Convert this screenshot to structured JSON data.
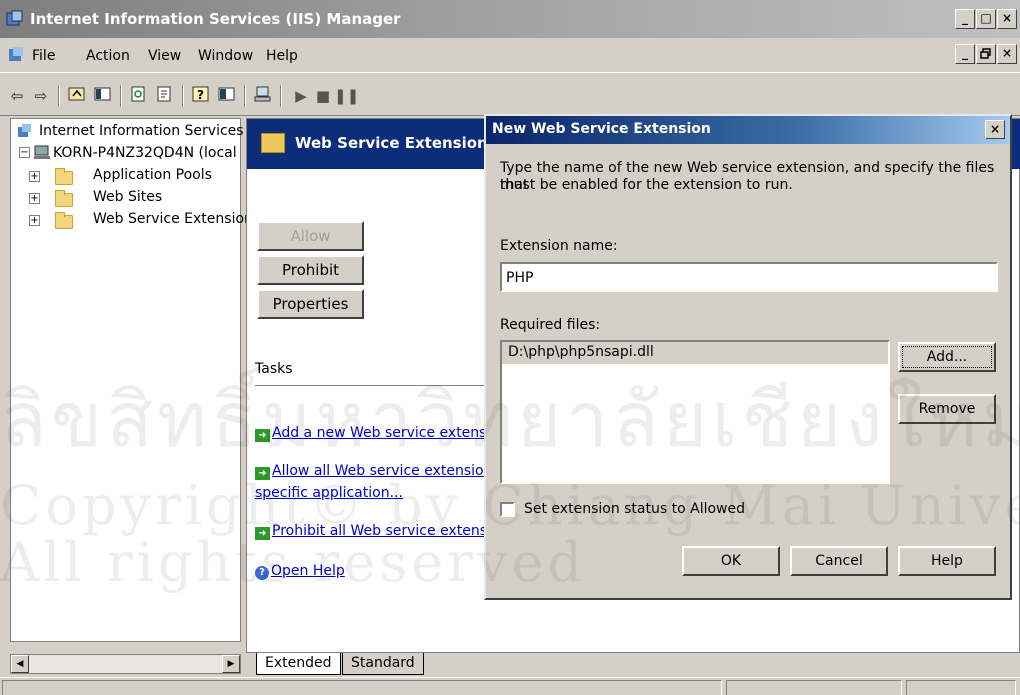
{
  "window": {
    "title": "Internet Information Services (IIS) Manager",
    "caption_minimize": "_",
    "caption_maximize": "□",
    "caption_close": "×",
    "mdi_minimize": "_",
    "mdi_restore": "ฮ",
    "mdi_close": "×"
  },
  "menu": {
    "items": [
      "File",
      "Action",
      "View",
      "Window",
      "Help"
    ]
  },
  "tree": {
    "root": "Internet Information Services",
    "server": "KORN-P4NZ32QD4N (local",
    "children": [
      "Application Pools",
      "Web Sites",
      "Web Service Extensior"
    ]
  },
  "pane": {
    "header": "Web Service Extensions",
    "buttons": {
      "allow": "Allow",
      "prohibit": "Prohibit",
      "properties": "Properties"
    },
    "tasks_label": "Tasks",
    "tasks": [
      "Add a new Web service extensio",
      "Allow all Web service extensions",
      "specific application...",
      "Prohibit all Web service extensior",
      "Open Help"
    ],
    "tabs": [
      "Extended",
      "Standard"
    ]
  },
  "dialog": {
    "title": "New Web Service Extension",
    "close": "×",
    "description_line1": "Type the name of the new Web service extension, and specify the files that",
    "description_line2": "must be enabled for the extension to run.",
    "extension_name_label": "Extension name:",
    "extension_name_value": "PHP",
    "required_files_label": "Required files:",
    "required_files": [
      "D:\\php\\php5nsapi.dll"
    ],
    "add_button": "Add...",
    "remove_button": "Remove",
    "checkbox_label": "Set extension status to Allowed",
    "checkbox_checked": false,
    "ok_button": "OK",
    "cancel_button": "Cancel",
    "help_button": "Help"
  },
  "watermark": {
    "line1": "ลิขสิทธิ์มหาวิทยาลัยเชียงใหม่",
    "line2": "Copyright© by Chiang Mai University",
    "line3": "All rights reserved"
  },
  "colors": {
    "header_blue": "#0c2d7a",
    "dialog_title_start": "#0a246a",
    "link": "#0000cc",
    "face": "#d4d0c8"
  }
}
